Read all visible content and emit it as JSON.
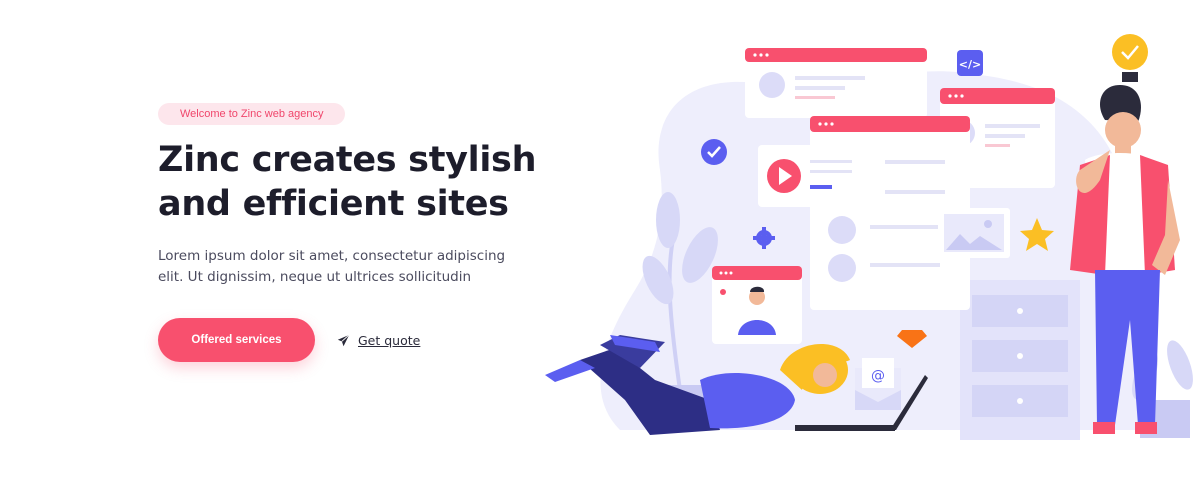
{
  "hero": {
    "badge": "Welcome to Zinc web agency",
    "headline_line1": "Zinc creates stylish",
    "headline_line2": "and efficient sites",
    "lead_line1": "Lorem ipsum dolor sit amet, consectetur adipiscing",
    "lead_line2": "elit. Ut dignissim, neque ut ultrices sollicitudin"
  },
  "actions": {
    "primary_label": "Offered services",
    "secondary_label": "Get quote"
  },
  "illustration": {
    "code_badge": "</>",
    "email_symbol": "@"
  },
  "colors": {
    "accent": "#f8506e",
    "badge_bg": "#fde6ec",
    "purple": "#5b5ef0",
    "light_purple": "#e9e9fb",
    "star": "#fbbf24"
  }
}
